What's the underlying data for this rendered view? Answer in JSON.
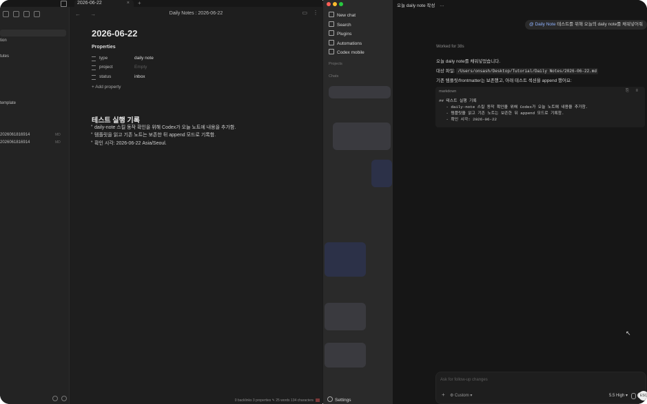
{
  "obsidian": {
    "tab_title": "2026-06-22",
    "tab_close": "×",
    "tab_add": "+",
    "view_title": "Daily Notes : 2026-06-22",
    "nav_arrows": "← →",
    "sidebar_items": [
      {
        "label": "tion",
        "badge": ""
      },
      {
        "label": "tutes",
        "badge": ""
      },
      {
        "label": "template",
        "badge": ""
      },
      {
        "label": "2026061816914",
        "badge": "MD"
      },
      {
        "label": "2026061816914",
        "badge": "MD"
      }
    ],
    "note": {
      "title": "2026-06-22",
      "properties_heading": "Properties",
      "properties": [
        {
          "key": "type",
          "value": "daily note",
          "empty": false
        },
        {
          "key": "project",
          "value": "Empty",
          "empty": true
        },
        {
          "key": "status",
          "value": "inbox",
          "empty": false
        }
      ],
      "add_property": "+ Add property",
      "section_heading": "테스트 실행 기록",
      "bullets": [
        "daily-note 스킬 동작 확인을 위해 Codex가 오늘 노트에 내용을 추가함.",
        "템플릿을 읽고 기존 노트는 보존한 뒤 append 모드로 기록함.",
        "확인 시각: 2026-06-22 Asia/Seoul."
      ]
    },
    "status_bar": "0 backlinks   3 properties   ✎ 25 words   134 characters"
  },
  "codex": {
    "menu": [
      "New chat",
      "Search",
      "Plugins",
      "Automations",
      "Codex mobile"
    ],
    "groups": [
      "Projects",
      "Chats"
    ],
    "settings_label": "Settings",
    "thread_title": "오늘 daily note 작성",
    "thread_menu": "···",
    "user_message_tag": "@ Daily Note",
    "user_message_text": " 테스트를 위해 오늘의 daily note를 채워넣어줘",
    "worked_for": "Worked for 38s",
    "response_intro": "오늘 daily note를 채워넣었습니다.",
    "target_file_label": "대상 파일: ",
    "target_file_path": "/Users/onsash/Desktop/Tutorial/Daily Notes/2026-06-22.md",
    "response_detail": "기존 템플릿/frontmatter는 보존했고, 아래 테스트 섹션을 append 했어요:",
    "code_lang": "markdown",
    "code_actions": "⎘ ≡",
    "code_lines": [
      "## 테스트 실행 기록",
      "   - daily-note 스킬 동작 확인을 위해 Codex가 오늘 노트에 내용을 추가함.",
      "   - 템플릿을 읽고 기존 노트는 보존한 뒤 append 모드로 기록함.",
      "   - 확인 시각: 2026-06-22"
    ],
    "composer_placeholder": "Ask for follow-up changes",
    "composer_mode": "⚙ Custom ▾",
    "composer_model": "5.5 High ▾"
  },
  "overlay": {
    "cursor": "↖",
    "esc_label": "ESC"
  },
  "colors": {
    "traffic_red": "#ff5f57",
    "traffic_yellow": "#febc2e",
    "traffic_green": "#28c840",
    "link_blue": "#8fb2ff"
  }
}
